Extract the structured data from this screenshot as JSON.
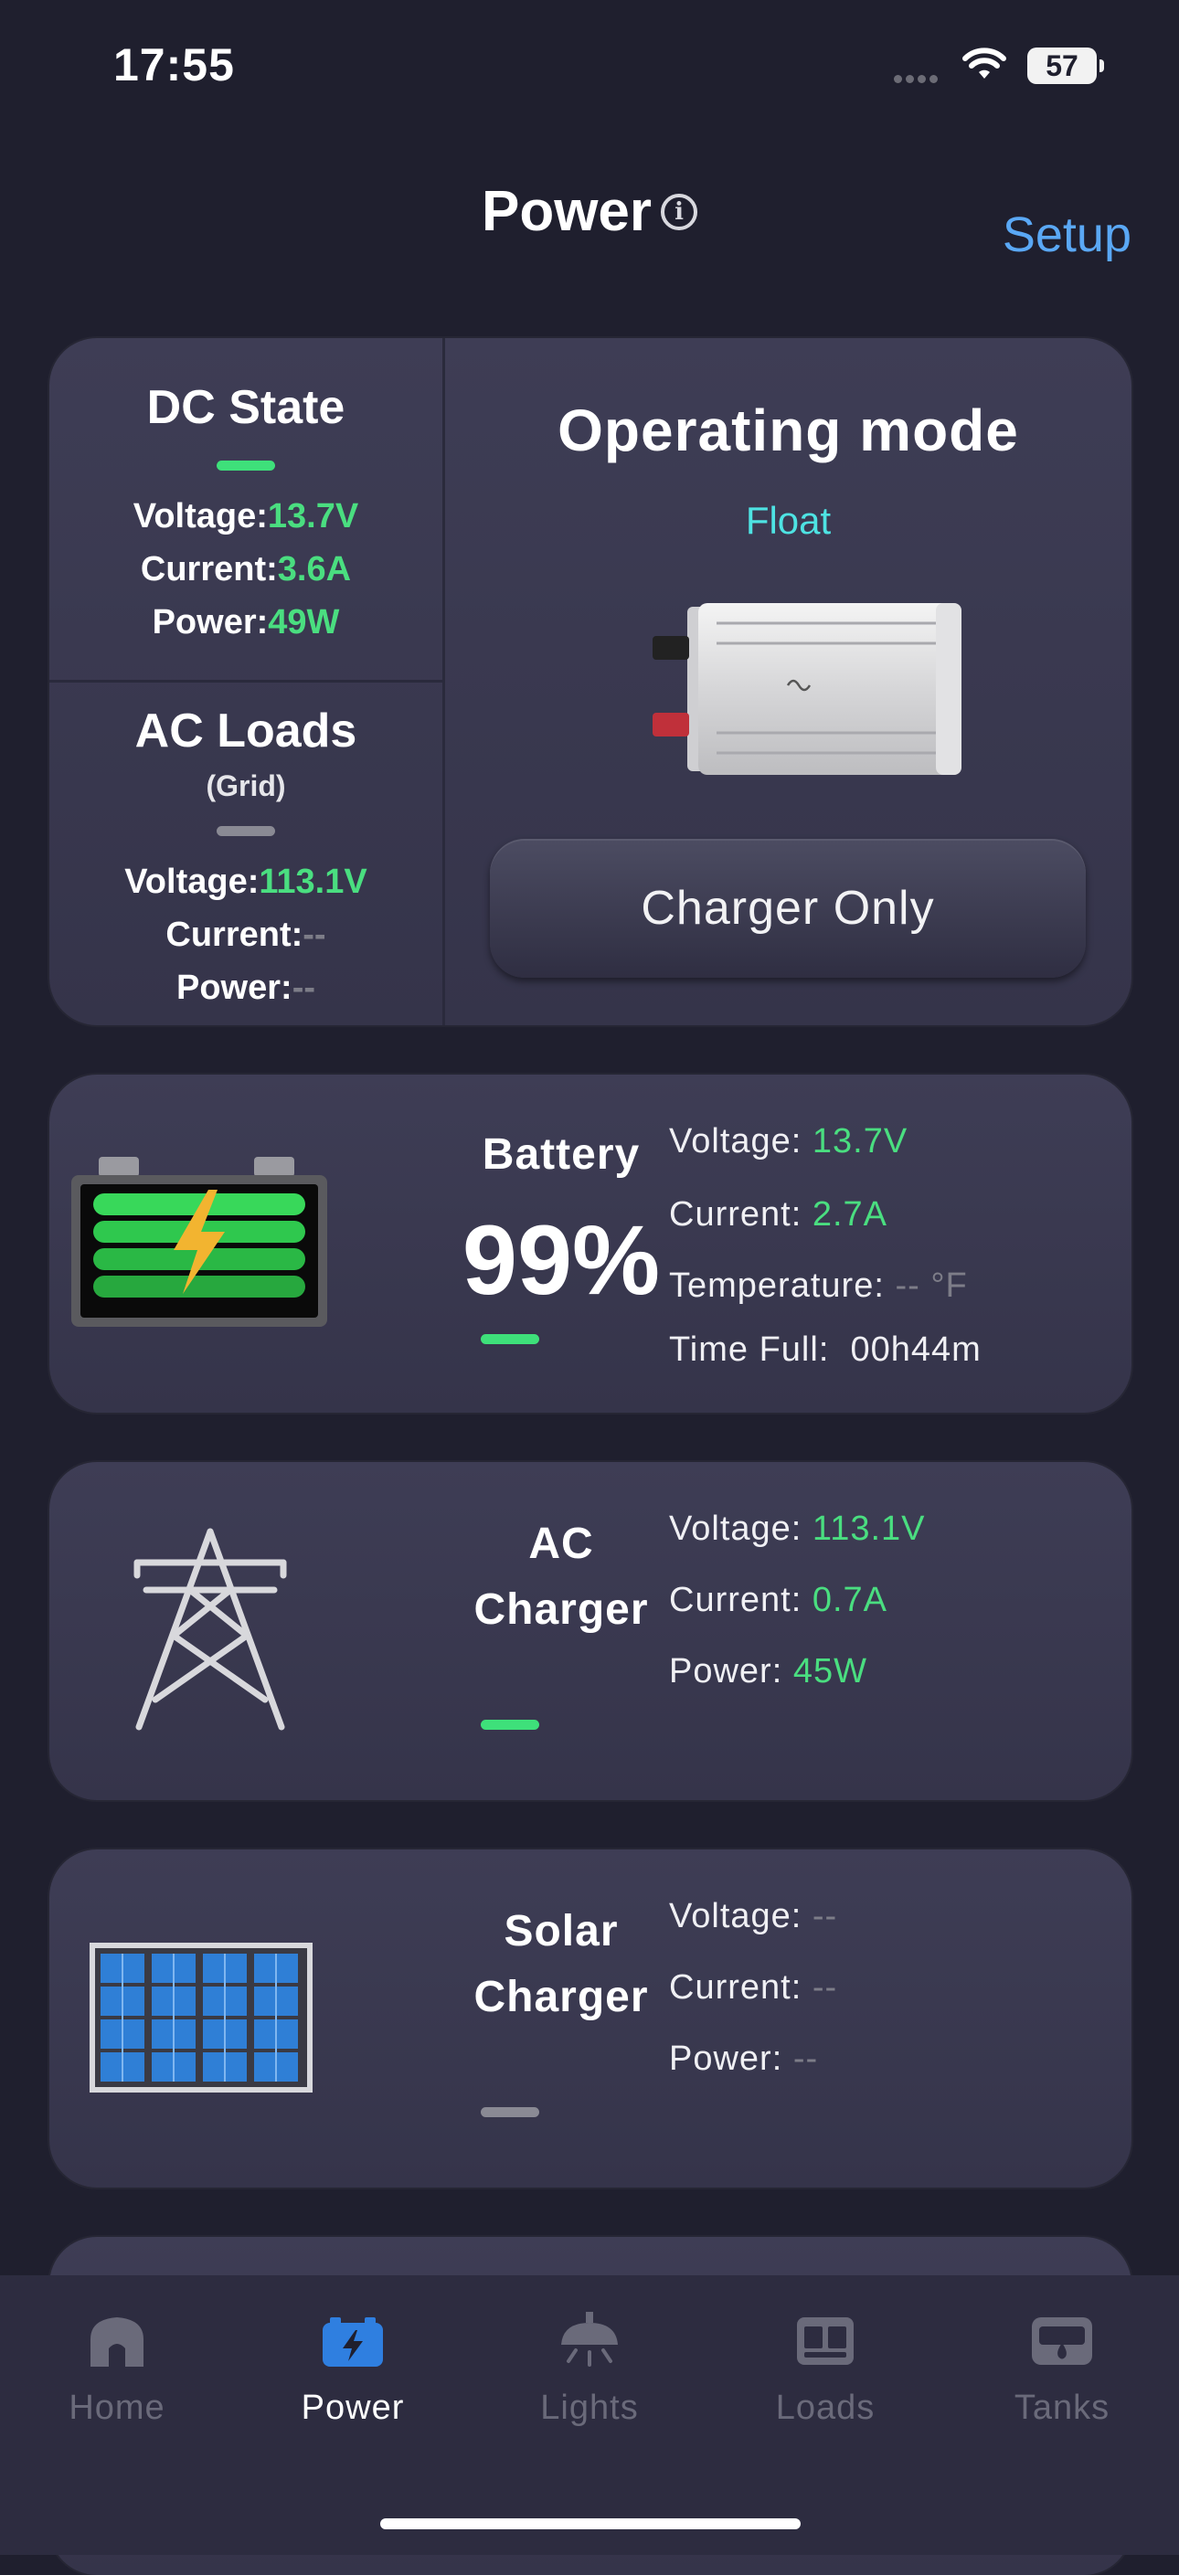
{
  "status_bar": {
    "time": "17:55",
    "battery": "57"
  },
  "header": {
    "title": "Power",
    "setup": "Setup"
  },
  "dc_state": {
    "title": "DC State",
    "voltage_label": "Voltage:",
    "voltage": "13.7V",
    "current_label": "Current:",
    "current": "3.6A",
    "power_label": "Power:",
    "power": "49W"
  },
  "ac_loads": {
    "title": "AC Loads",
    "subtitle": "(Grid)",
    "voltage_label": "Voltage:",
    "voltage": "113.1V",
    "current_label": "Current:",
    "current": "--",
    "power_label": "Power:",
    "power": "--"
  },
  "operating": {
    "title": "Operating mode",
    "mode": "Float",
    "button": "Charger Only"
  },
  "battery": {
    "title": "Battery",
    "percent": "99%",
    "voltage_label": "Voltage:",
    "voltage": "13.7V",
    "current_label": "Current:",
    "current": "2.7A",
    "temperature_label": "Temperature:",
    "temperature": "-- °F",
    "time_full_label": "Time Full:",
    "time_full": "00h44m"
  },
  "ac_charger": {
    "title_line1": "AC",
    "title_line2": "Charger",
    "voltage_label": "Voltage:",
    "voltage": "113.1V",
    "current_label": "Current:",
    "current": "0.7A",
    "power_label": "Power:",
    "power": "45W"
  },
  "solar_charger": {
    "title_line1": "Solar",
    "title_line2": "Charger",
    "voltage_label": "Voltage:",
    "voltage": "--",
    "current_label": "Current:",
    "current": "--",
    "power_label": "Power:",
    "power": "--"
  },
  "tabs": [
    {
      "label": "Home",
      "icon": "home-icon"
    },
    {
      "label": "Power",
      "icon": "battery-icon"
    },
    {
      "label": "Lights",
      "icon": "light-icon"
    },
    {
      "label": "Loads",
      "icon": "loads-icon"
    },
    {
      "label": "Tanks",
      "icon": "tank-icon"
    }
  ],
  "colors": {
    "accent_green": "#4ade80",
    "accent_blue": "#5aa8f5",
    "mode_cyan": "#4ee3e3",
    "background": "#1f1f2e"
  }
}
